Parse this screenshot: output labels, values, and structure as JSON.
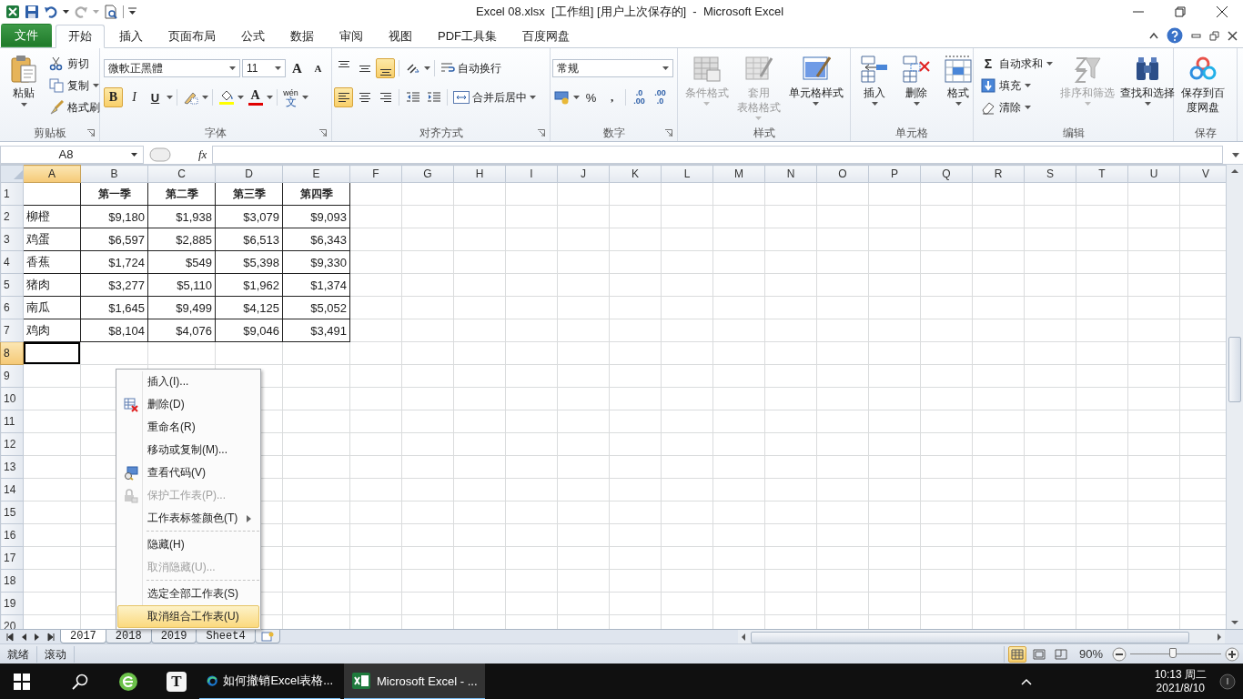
{
  "title_bar": {
    "title": "Excel 08.xlsx  [工作组] [用户上次保存的]  -  Microsoft Excel"
  },
  "ribbon_tabs": [
    {
      "label": "文件",
      "kind": "file",
      "selected": false
    },
    {
      "label": "开始",
      "kind": "tab",
      "selected": true
    },
    {
      "label": "插入",
      "kind": "tab",
      "selected": false
    },
    {
      "label": "页面布局",
      "kind": "tab",
      "selected": false
    },
    {
      "label": "公式",
      "kind": "tab",
      "selected": false
    },
    {
      "label": "数据",
      "kind": "tab",
      "selected": false
    },
    {
      "label": "审阅",
      "kind": "tab",
      "selected": false
    },
    {
      "label": "视图",
      "kind": "tab",
      "selected": false
    },
    {
      "label": "PDF工具集",
      "kind": "tab",
      "selected": false
    },
    {
      "label": "百度网盘",
      "kind": "tab",
      "selected": false
    }
  ],
  "ribbon": {
    "clipboard": {
      "label": "剪贴板",
      "paste": "粘贴",
      "cut": "剪切",
      "copy": "复制",
      "format_painter": "格式刷"
    },
    "font": {
      "label": "字体",
      "font_name": "微軟正黑體",
      "font_size": "11",
      "grow": "A",
      "shrink": "A",
      "bold": {
        "label": "B",
        "selected": true
      },
      "italic": {
        "label": "I",
        "selected": false
      },
      "underline": {
        "label": "U",
        "selected": false
      },
      "font_color": "A",
      "phonetic_top": "wén",
      "phonetic_bottom": "文"
    },
    "alignment": {
      "label": "对齐方式",
      "wrap_text": "自动换行",
      "merge_center": "合并后居中",
      "vertical": [
        {
          "selected": false
        },
        {
          "selected": false
        },
        {
          "selected": true
        }
      ],
      "horizontal": [
        {
          "selected": true
        },
        {
          "selected": false
        },
        {
          "selected": false
        }
      ]
    },
    "number": {
      "label": "数字",
      "format": "常规",
      "percent": "%",
      "comma": ",",
      "increase_decimal": {
        "top": ".0",
        "bottom": ".00"
      },
      "decrease_decimal": {
        "top": ".00",
        "bottom": ".0"
      }
    },
    "styles": {
      "label": "样式",
      "buttons": [
        {
          "lines": [
            "条件格式"
          ],
          "disabled": true
        },
        {
          "lines": [
            "套用",
            "表格格式"
          ],
          "disabled": true
        },
        {
          "lines": [
            "单元格样式"
          ],
          "disabled": false
        }
      ]
    },
    "cells": {
      "label": "单元格",
      "buttons": [
        {
          "lines": [
            "插入"
          ],
          "disabled": false
        },
        {
          "lines": [
            "删除"
          ],
          "disabled": false
        },
        {
          "lines": [
            "格式"
          ],
          "disabled": false
        }
      ]
    },
    "editing": {
      "label": "编辑",
      "autosum_symbol": "Σ",
      "autosum": "自动求和",
      "fill": "填充",
      "clear": "清除",
      "buttons": [
        {
          "lines": [
            "排序和筛选"
          ],
          "disabled": true
        },
        {
          "lines": [
            "查找和选择"
          ],
          "disabled": false
        }
      ]
    },
    "save": {
      "label": "保存",
      "buttons": [
        {
          "lines": [
            "保存到百",
            "度网盘"
          ],
          "disabled": false
        }
      ]
    }
  },
  "formula_bar": {
    "name_box": "A8",
    "function_label": "fx"
  },
  "sheet": {
    "columns": [
      {
        "label": "A",
        "selected": true
      },
      {
        "label": "B",
        "selected": false
      },
      {
        "label": "C",
        "selected": false
      },
      {
        "label": "D",
        "selected": false
      },
      {
        "label": "E",
        "selected": false
      },
      {
        "label": "F",
        "selected": false
      },
      {
        "label": "G",
        "selected": false
      },
      {
        "label": "H",
        "selected": false
      },
      {
        "label": "I",
        "selected": false
      },
      {
        "label": "J",
        "selected": false
      },
      {
        "label": "K",
        "selected": false
      },
      {
        "label": "L",
        "selected": false
      },
      {
        "label": "M",
        "selected": false
      },
      {
        "label": "N",
        "selected": false
      },
      {
        "label": "O",
        "selected": false
      },
      {
        "label": "P",
        "selected": false
      },
      {
        "label": "Q",
        "selected": false
      },
      {
        "label": "R",
        "selected": false
      },
      {
        "label": "S",
        "selected": false
      },
      {
        "label": "T",
        "selected": false
      },
      {
        "label": "U",
        "selected": false
      },
      {
        "label": "V",
        "selected": false
      }
    ],
    "rows": [
      {
        "label": "1",
        "kind": "header",
        "selected": false,
        "cells": [
          null,
          "第一季",
          "第二季",
          "第三季",
          "第四季"
        ]
      },
      {
        "label": "2",
        "kind": "data",
        "selected": false,
        "cells": [
          "柳橙",
          "$9,180",
          "$1,938",
          "$3,079",
          "$9,093"
        ]
      },
      {
        "label": "3",
        "kind": "data",
        "selected": false,
        "cells": [
          "鸡蛋",
          "$6,597",
          "$2,885",
          "$6,513",
          "$6,343"
        ]
      },
      {
        "label": "4",
        "kind": "data",
        "selected": false,
        "cells": [
          "香蕉",
          "$1,724",
          "$549",
          "$5,398",
          "$9,330"
        ]
      },
      {
        "label": "5",
        "kind": "data",
        "selected": false,
        "cells": [
          "猪肉",
          "$3,277",
          "$5,110",
          "$1,962",
          "$1,374"
        ]
      },
      {
        "label": "6",
        "kind": "data",
        "selected": false,
        "cells": [
          "南瓜",
          "$1,645",
          "$9,499",
          "$4,125",
          "$5,052"
        ]
      },
      {
        "label": "7",
        "kind": "data",
        "selected": false,
        "cells": [
          "鸡肉",
          "$8,104",
          "$4,076",
          "$9,046",
          "$3,491"
        ]
      },
      {
        "label": "8",
        "kind": "empty",
        "selected": true
      },
      {
        "label": "9",
        "kind": "empty",
        "selected": false
      },
      {
        "label": "10",
        "kind": "empty",
        "selected": false
      },
      {
        "label": "11",
        "kind": "empty",
        "selected": false
      },
      {
        "label": "12",
        "kind": "empty",
        "selected": false
      },
      {
        "label": "13",
        "kind": "empty",
        "selected": false
      },
      {
        "label": "14",
        "kind": "empty",
        "selected": false
      },
      {
        "label": "15",
        "kind": "empty",
        "selected": false
      },
      {
        "label": "16",
        "kind": "empty",
        "selected": false
      },
      {
        "label": "17",
        "kind": "empty",
        "selected": false
      },
      {
        "label": "18",
        "kind": "empty",
        "selected": false
      },
      {
        "label": "19",
        "kind": "empty",
        "selected": false
      },
      {
        "label": "20",
        "kind": "empty",
        "selected": false
      }
    ]
  },
  "context_menu": {
    "items": [
      {
        "kind": "item",
        "label": "插入(I)...",
        "disabled": false,
        "selected": false,
        "submenu": false
      },
      {
        "kind": "item",
        "label": "删除(D)",
        "disabled": false,
        "selected": false,
        "submenu": false
      },
      {
        "kind": "item",
        "label": "重命名(R)",
        "disabled": false,
        "selected": false,
        "submenu": false
      },
      {
        "kind": "item",
        "label": "移动或复制(M)...",
        "disabled": false,
        "selected": false,
        "submenu": false
      },
      {
        "kind": "item",
        "label": "查看代码(V)",
        "disabled": false,
        "selected": false,
        "submenu": false
      },
      {
        "kind": "item",
        "label": "保护工作表(P)...",
        "disabled": true,
        "selected": false,
        "submenu": false
      },
      {
        "kind": "item",
        "label": "工作表标签颜色(T)",
        "disabled": false,
        "selected": false,
        "submenu": true
      },
      {
        "kind": "separator"
      },
      {
        "kind": "item",
        "label": "隐藏(H)",
        "disabled": false,
        "selected": false,
        "submenu": false
      },
      {
        "kind": "item",
        "label": "取消隐藏(U)...",
        "disabled": true,
        "selected": false,
        "submenu": false
      },
      {
        "kind": "separator"
      },
      {
        "kind": "item",
        "label": "选定全部工作表(S)",
        "disabled": false,
        "selected": false,
        "submenu": false
      },
      {
        "kind": "item",
        "label": "取消组合工作表(U)",
        "disabled": false,
        "selected": true,
        "submenu": false
      }
    ]
  },
  "sheet_tabs": [
    {
      "label": "2017",
      "selected": true
    },
    {
      "label": "2018",
      "selected": false
    },
    {
      "label": "2019",
      "selected": false
    },
    {
      "label": "Sheet4",
      "selected": false
    }
  ],
  "status_bar": {
    "mode": "就绪",
    "scroll": "滚动",
    "views": [
      {
        "selected": true
      },
      {
        "selected": false
      },
      {
        "selected": false
      }
    ],
    "zoom": "90%",
    "zoom_slider": {
      "level": 0.47
    }
  },
  "taskbar": {
    "pinned_letter": "T",
    "apps": [
      {
        "label": "如何撤销Excel表格...",
        "selected": false
      },
      {
        "label": "Microsoft Excel - ...",
        "selected": true
      }
    ],
    "time": "10:13 周二",
    "date": "2021/8/10"
  }
}
